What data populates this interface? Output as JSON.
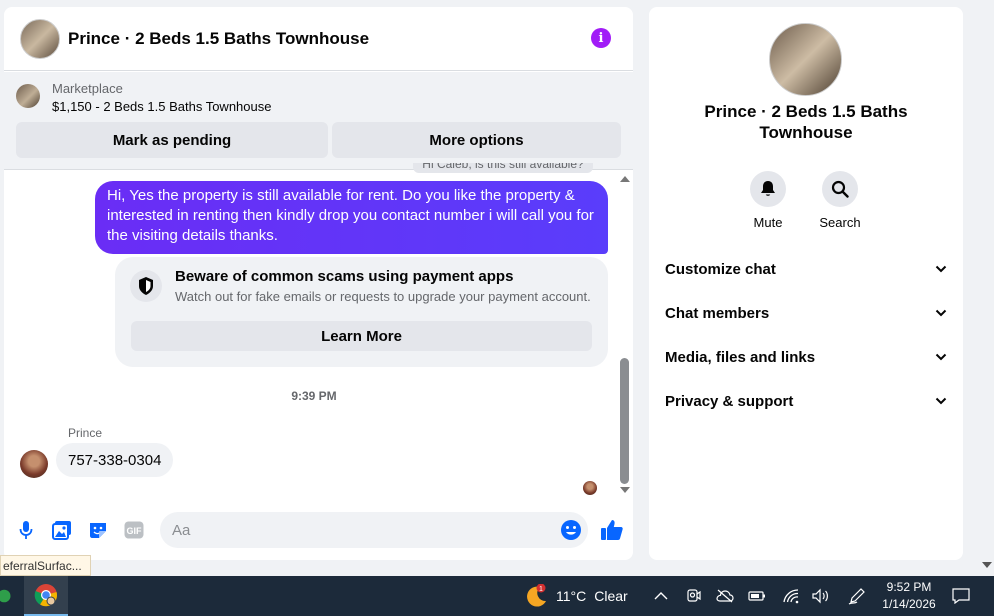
{
  "chat": {
    "title": "Prince · 2 Beds 1.5 Baths Townhouse",
    "marketplace_label": "Marketplace",
    "listing_title": "$1,150 - 2 Beds 1.5 Baths Townhouse",
    "mark_pending": "Mark as pending",
    "more_options": "More options",
    "previous_message_fragment": "Hi Caleb, is this still available?",
    "outgoing_message": "Hi, Yes the property is still available for rent. Do you like the property & interested in renting then kindly drop you contact number i will call you for the visiting details thanks.",
    "scam_title": "Beware of common scams using payment apps",
    "scam_subtitle": "Watch out for fake emails or requests to upgrade your payment account.",
    "learn_more": "Learn More",
    "timestamp": "9:39 PM",
    "sender_name": "Prince",
    "incoming_message": "757-338-0304",
    "input_placeholder": "Aa"
  },
  "info_panel": {
    "title": "Prince · 2 Beds 1.5 Baths Townhouse",
    "mute": "Mute",
    "search": "Search",
    "rows": [
      "Customize chat",
      "Chat members",
      "Media, files and links",
      "Privacy & support"
    ]
  },
  "tooltip": "eferralSurfac...",
  "taskbar": {
    "weather_badge": "1",
    "weather": "11°C",
    "condition": "Clear",
    "time": "9:52 PM",
    "date": "1/14/2026"
  },
  "colors": {
    "accent_purple": "#a11cf7",
    "bubble_blue": "#5a3dfb",
    "messenger_blue": "#0866ff",
    "taskbar": "#1c2a3a"
  }
}
